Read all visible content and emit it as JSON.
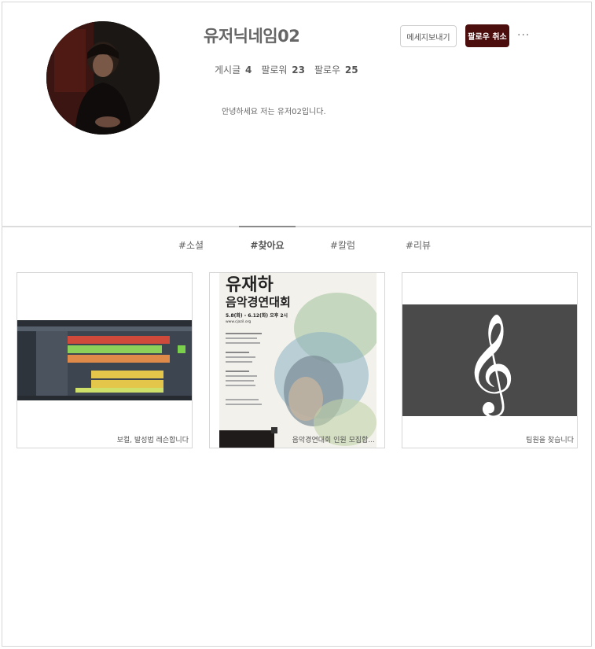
{
  "profile": {
    "nickname": "유저닉네임02",
    "bio": "안녕하세요 저는 유저02입니다.",
    "stats": [
      {
        "label": "게시글",
        "value": "4"
      },
      {
        "label": "팔로워",
        "value": "23"
      },
      {
        "label": "팔로우",
        "value": "25"
      }
    ],
    "message_button": "메세지보내기",
    "unfollow_button": "팔로우 취소",
    "more_icon": "more-horizontal-icon"
  },
  "tabs": [
    {
      "label": "#소셜",
      "active": false
    },
    {
      "label": "#찾아요",
      "active": true
    },
    {
      "label": "#칼럼",
      "active": false
    },
    {
      "label": "#리뷰",
      "active": false
    }
  ],
  "posts": [
    {
      "caption": "보컬, 발성법 레슨합니다",
      "image": "daw-screenshot"
    },
    {
      "caption": "음악경연대회 인원 모집합...",
      "image": "music-contest-poster",
      "poster_title": "유재하",
      "poster_subtitle": "음악경연대회",
      "poster_date": "5.8(화) - 6.12(화) 오후 2시",
      "poster_url": "www.cjazil.org"
    },
    {
      "caption": "팀원을 찾습니다",
      "image": "treble-clef-icon"
    }
  ],
  "colors": {
    "accent": "#4c0d0d",
    "border": "#d6d6d6",
    "text": "#666666",
    "clef_bg": "#4a4a4a"
  }
}
